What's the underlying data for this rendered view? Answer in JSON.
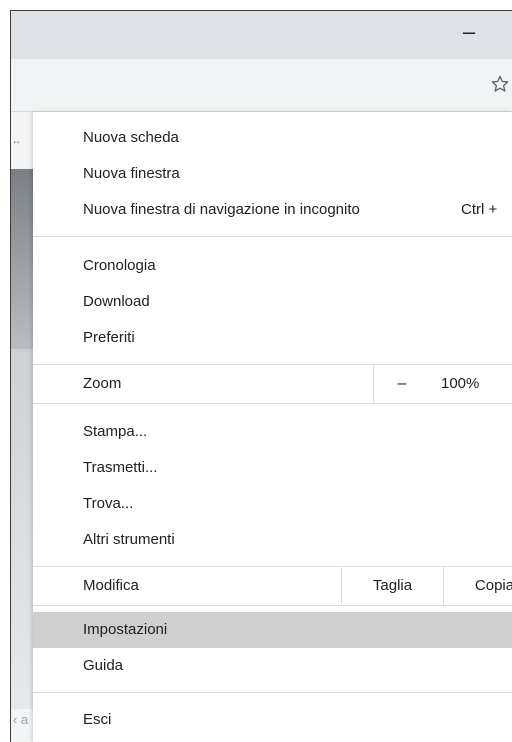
{
  "window": {
    "minimize_glyph": "–",
    "bookmark_icon": "star-outline-icon"
  },
  "menu": {
    "group1": [
      {
        "label": "Nuova scheda"
      },
      {
        "label": "Nuova finestra"
      },
      {
        "label": "Nuova finestra di navigazione in incognito",
        "shortcut": "Ctrl +"
      }
    ],
    "group2": [
      {
        "label": "Cronologia"
      },
      {
        "label": "Download"
      },
      {
        "label": "Preferiti"
      }
    ],
    "zoom": {
      "label": "Zoom",
      "minus": "–",
      "level": "100%"
    },
    "group3": [
      {
        "label": "Stampa..."
      },
      {
        "label": "Trasmetti..."
      },
      {
        "label": "Trova..."
      },
      {
        "label": "Altri strumenti"
      }
    ],
    "edit": {
      "label": "Modifica",
      "cut": "Taglia",
      "copy": "Copia"
    },
    "group4": [
      {
        "label": "Impostazioni",
        "highlighted": true
      },
      {
        "label": "Guida"
      }
    ],
    "exit": {
      "label": "Esci"
    }
  },
  "background_page": {
    "ellipsis": "..",
    "bottom_text": "‹ a"
  },
  "colors": {
    "titlebar": "#dee1e6",
    "toolbar": "#f1f3f4",
    "highlight": "#cfcfcf",
    "separator": "#dadce0"
  }
}
